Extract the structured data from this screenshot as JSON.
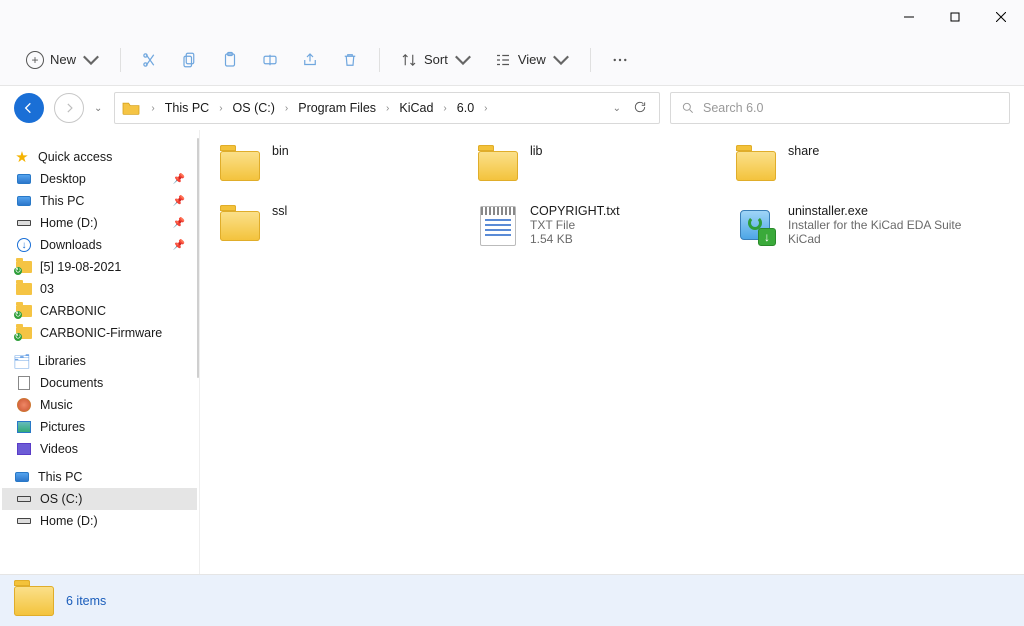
{
  "titlebar": {},
  "ribbon": {
    "new_label": "New",
    "sort_label": "Sort",
    "view_label": "View"
  },
  "breadcrumb": {
    "items": [
      "This PC",
      "OS (C:)",
      "Program Files",
      "KiCad",
      "6.0"
    ]
  },
  "search": {
    "placeholder": "Search 6.0"
  },
  "sidebar": {
    "quick_access": "Quick access",
    "desktop": "Desktop",
    "this_pc": "This PC",
    "home_d": "Home (D:)",
    "downloads": "Downloads",
    "dated": "[5] 19-08-2021",
    "zero3": "03",
    "carbonic": "CARBONIC",
    "carbonic_fw": "CARBONIC-Firmware",
    "libraries": "Libraries",
    "documents": "Documents",
    "music": "Music",
    "pictures": "Pictures",
    "videos": "Videos",
    "this_pc2": "This PC",
    "os_c": "OS (C:)",
    "home_d2": "Home (D:)"
  },
  "files": {
    "bin": {
      "name": "bin"
    },
    "lib": {
      "name": "lib"
    },
    "share": {
      "name": "share"
    },
    "ssl": {
      "name": "ssl"
    },
    "copyright": {
      "name": "COPYRIGHT.txt",
      "type": "TXT File",
      "size": "1.54 KB"
    },
    "uninstaller": {
      "name": "uninstaller.exe",
      "line1": "Installer for the KiCad EDA Suite",
      "line2": "KiCad"
    }
  },
  "status": {
    "count": "6 items"
  }
}
